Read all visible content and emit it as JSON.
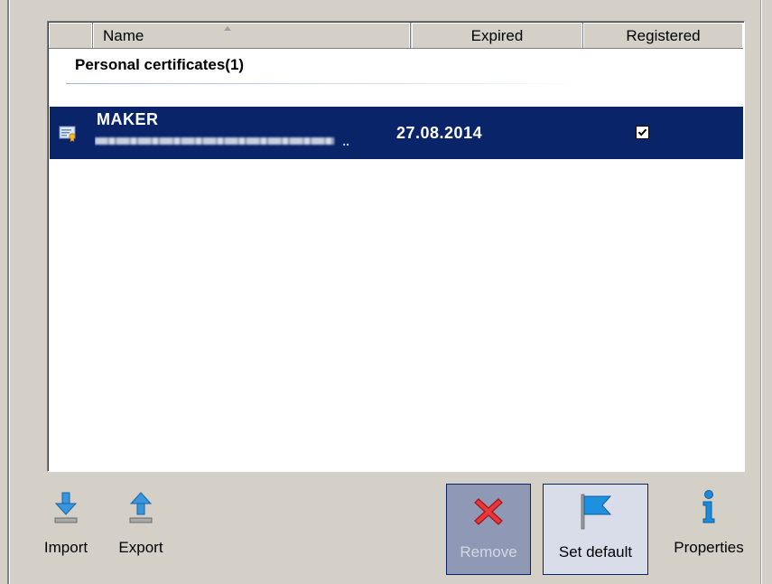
{
  "columns": {
    "name": "Name",
    "expired": "Expired",
    "registered": "Registered"
  },
  "group": {
    "title": "Personal certificates(1)"
  },
  "certificates": [
    {
      "name": "MAKER",
      "subject_dots": "..",
      "expired": "27.08.2014",
      "registered": true,
      "selected": true
    }
  ],
  "toolbar": {
    "import_label": "Import",
    "export_label": "Export",
    "remove_label": "Remove",
    "set_default_label": "Set default",
    "properties_label": "Properties"
  },
  "colors": {
    "selection": "#0a246a",
    "window_bg": "#d4d0c8",
    "accent_blue": "#1e88d9",
    "remove_red": "#e8363a"
  },
  "icons": {
    "import": "import-arrow-icon",
    "export": "export-arrow-icon",
    "remove": "red-x-icon",
    "set_default": "flag-icon",
    "properties": "info-icon",
    "certificate": "certificate-icon"
  }
}
